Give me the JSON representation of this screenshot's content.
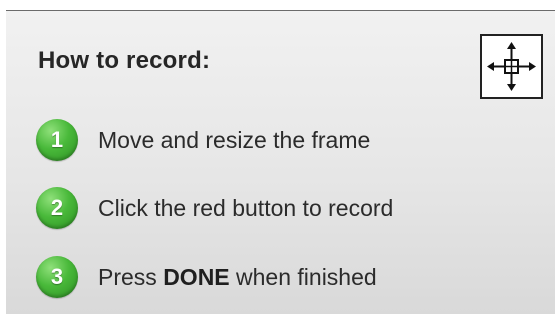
{
  "panel": {
    "title": "How to record:",
    "move_button": {
      "icon": "move-arrows-icon"
    }
  },
  "steps": [
    {
      "number": "1",
      "text": "Move and resize the frame"
    },
    {
      "number": "2",
      "text": "Click the red button to record"
    },
    {
      "number": "3",
      "text_before": "Press ",
      "text_bold": "DONE",
      "text_after": " when finished"
    }
  ],
  "colors": {
    "badge_green": "#3fae32",
    "text": "#2b2b2b",
    "panel_bg": "#e6e6e6"
  }
}
